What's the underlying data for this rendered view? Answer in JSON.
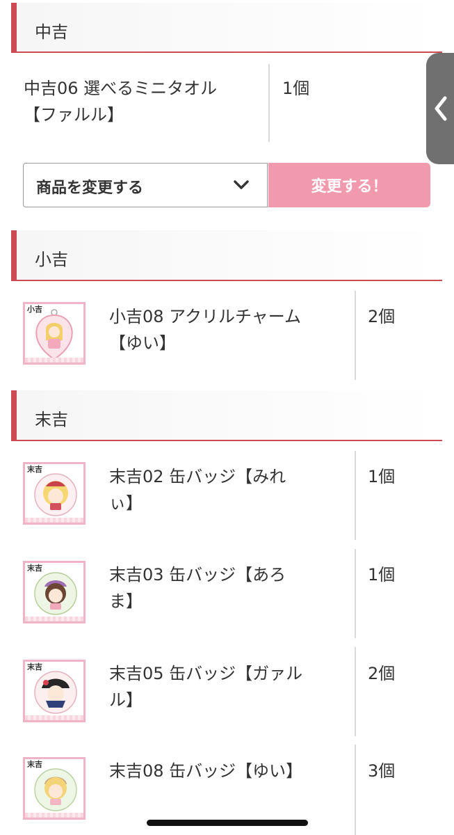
{
  "sections": [
    {
      "title": "中吉"
    },
    {
      "title": "小吉"
    },
    {
      "title": "末吉"
    }
  ],
  "chukichi_item": {
    "name": "中吉06 選べるミニタオル\n【ファルル】",
    "qty": "1個"
  },
  "change_form": {
    "select_label": "商品を変更する",
    "button_label": "変更する！"
  },
  "shokichi_items": [
    {
      "name": "小吉08 アクリルチャーム\n【ゆい】",
      "qty": "2個",
      "badge": "小吉"
    }
  ],
  "suekichi_items": [
    {
      "name": "末吉02 缶バッジ【みれ\nぃ】",
      "qty": "1個",
      "badge": "末吉"
    },
    {
      "name": "末吉03 缶バッジ【あろ\nま】",
      "qty": "1個",
      "badge": "末吉"
    },
    {
      "name": "末吉05 缶バッジ【ガァル\nル】",
      "qty": "2個",
      "badge": "末吉"
    },
    {
      "name": "末吉08 缶バッジ【ゆい】",
      "qty": "3個",
      "badge": "末吉"
    }
  ],
  "colors": {
    "accent": "#cc4b53",
    "button": "#f19aae",
    "thumb_border": "#f1b3c6"
  },
  "icons": {
    "select": "chevron-down-icon",
    "side_tab": "chevron-left-icon"
  }
}
